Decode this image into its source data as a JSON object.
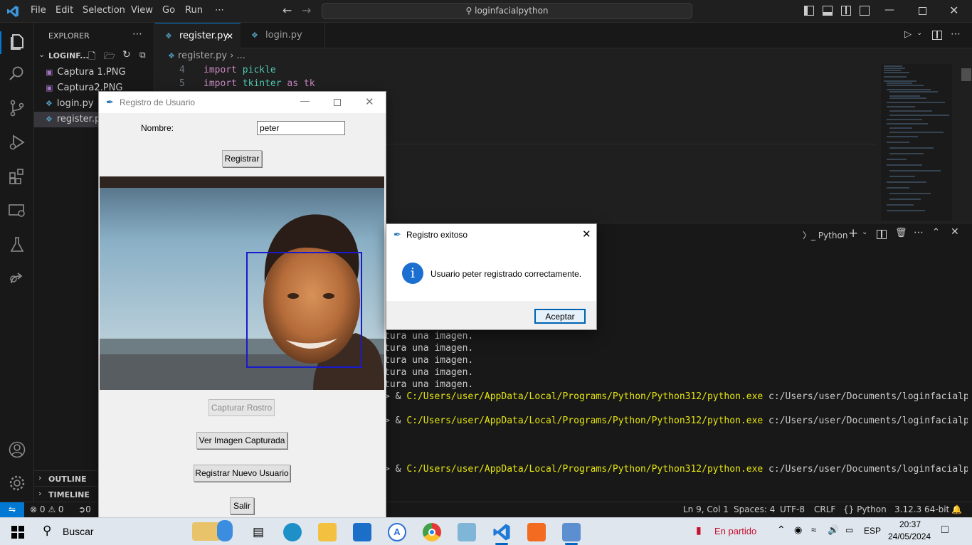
{
  "titlebar": {
    "menus": [
      "File",
      "Edit",
      "Selection",
      "View",
      "Go",
      "Run",
      "⋯"
    ],
    "search": "loginfacialpython"
  },
  "explorer": {
    "header": "EXPLORER",
    "more": "⋯",
    "folder": "LOGINF...",
    "files": [
      {
        "name": "Captura 1.PNG",
        "icon": "image-file-icon"
      },
      {
        "name": "Captura2.PNG",
        "icon": "image-file-icon"
      },
      {
        "name": "login.py",
        "icon": "python-file-icon"
      },
      {
        "name": "register.py",
        "icon": "python-file-icon"
      }
    ],
    "outline": "OUTLINE",
    "timeline": "TIMELINE"
  },
  "tabs": [
    {
      "label": "register.py",
      "active": true,
      "close": "✕"
    },
    {
      "label": "login.py",
      "active": false
    }
  ],
  "breadcrumb": {
    "file": "register.py",
    "rest": "..."
  },
  "code": [
    {
      "num": "4",
      "kw": "import",
      "mod": "pickle",
      "rest": ""
    },
    {
      "num": "5",
      "kw": "import",
      "mod": "tkinter",
      "rest": " as tk"
    }
  ],
  "terminal": {
    "profile": "Python",
    "lines": [
      {
        "text": "tura una imagen."
      },
      {
        "text": "tura una imagen."
      },
      {
        "text": "tura una imagen."
      },
      {
        "text": "tura una imagen."
      },
      {
        "text": "tura una imagen."
      },
      {
        "prefix": "> & ",
        "path": "C:/Users/user/AppData/Local/Programs/Python/Python312/python.exe",
        "rest": " c:/Users/user/Documents/loginfacialpython/reg"
      },
      {
        "prefix": "> & ",
        "path": "C:/Users/user/AppData/Local/Programs/Python/Python312/python.exe",
        "rest": " c:/Users/user/Documents/loginfacialpython/reg"
      },
      {
        "prefix": "> & ",
        "path": "C:/Users/user/AppData/Local/Programs/Python/Python312/python.exe",
        "rest": " c:/Users/user/Documents/loginfacialpython/reg"
      }
    ]
  },
  "status": {
    "errors": "0",
    "warnings": "0",
    "ports": "0",
    "position": "Ln 9, Col 1",
    "spaces": "Spaces: 4",
    "encoding": "UTF-8",
    "eol": "CRLF",
    "language": "Python",
    "interpreter": "3.12.3 64-bit"
  },
  "tk": {
    "title": "Registro de Usuario",
    "name_label": "Nombre:",
    "name_value": "peter",
    "register_btn": "Registrar",
    "capture_btn": "Capturar Rostro",
    "view_btn": "Ver Imagen Capturada",
    "new_user_btn": "Registrar Nuevo Usuario",
    "exit_btn": "Salir"
  },
  "msgbox": {
    "title": "Registro exitoso",
    "message": "Usuario peter registrado correctamente.",
    "ok": "Aceptar"
  },
  "taskbar": {
    "search": "Buscar",
    "weather": "En partido",
    "lang": "ESP",
    "time": "20:37",
    "date": "24/05/2024"
  }
}
